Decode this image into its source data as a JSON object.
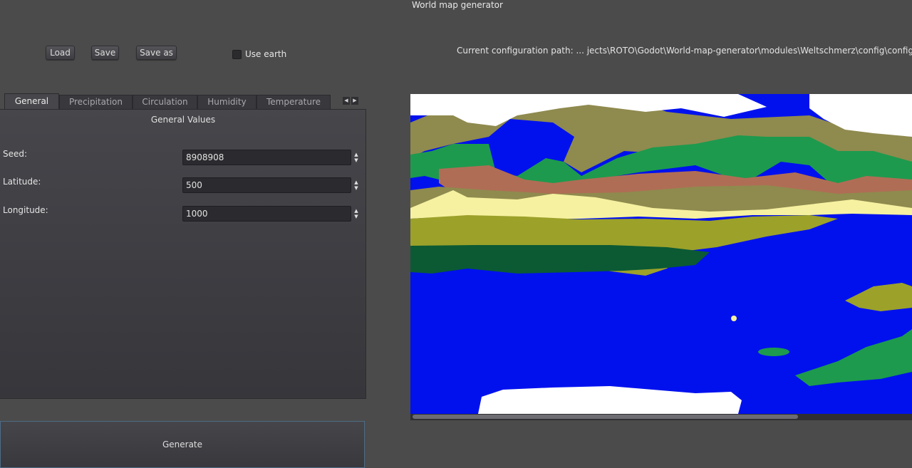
{
  "window": {
    "title": "World map generator"
  },
  "toolbar": {
    "load_label": "Load",
    "save_label": "Save",
    "save_as_label": "Save as"
  },
  "use_earth": {
    "label": "Use earth",
    "checked": false
  },
  "config": {
    "path_text": "Current configuration path:  ... jects\\ROTO\\Godot\\World-map-generator\\modules\\Weltschmerz\\config\\config.c"
  },
  "tabs": [
    {
      "label": "General",
      "active": true
    },
    {
      "label": "Precipitation",
      "active": false
    },
    {
      "label": "Circulation",
      "active": false
    },
    {
      "label": "Humidity",
      "active": false
    },
    {
      "label": "Temperature",
      "active": false
    }
  ],
  "tab_scroll": {
    "left_icon": "arrow-left-icon",
    "right_icon": "arrow-right-icon"
  },
  "general": {
    "title": "General Values",
    "seed": {
      "label": "Seed:",
      "value": "8908908"
    },
    "latitude": {
      "label": "Latitude:",
      "value": "500"
    },
    "longitude": {
      "label": "Longitude:",
      "value": "1000"
    }
  },
  "generate": {
    "label": "Generate"
  },
  "map": {
    "colors": {
      "water": "#0011ee",
      "ice": "#ffffff",
      "tundra": "#8f8a4e",
      "forest": "#1d9a4e",
      "dark_forest": "#0b5a34",
      "grassland": "#9ca12a",
      "desert": "#f6f1a0",
      "savanna": "#b06d55",
      "light_green": "#6cc275"
    }
  }
}
